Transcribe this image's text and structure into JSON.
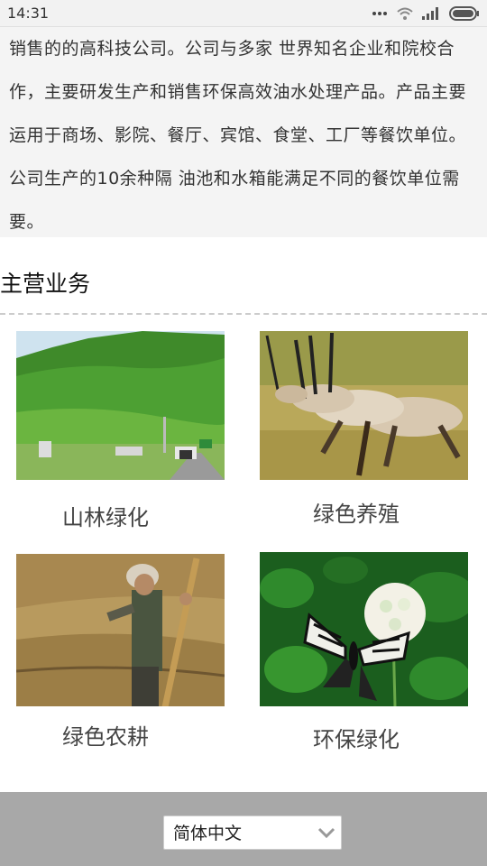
{
  "status_bar": {
    "time": "14:31",
    "icons": [
      "more-dots-icon",
      "wifi-icon",
      "signal-icon",
      "battery-icon"
    ]
  },
  "intro": {
    "paragraph": "销售的的高科技公司。公司与多家 世界知名企业和院校合作，主要研发生产和销售环保高效油水处理产品。产品主要运用于商场、影院、餐厅、宾馆、食堂、工厂等餐饮单位。公司生产的10余种隔 油池和水箱能满足不同的餐饮单位需要。"
  },
  "main_business": {
    "title": "主营业务",
    "items": [
      {
        "label": "山林绿化",
        "image": "forest-hill-highway-photo"
      },
      {
        "label": "绿色养殖",
        "image": "antelope-herd-photo"
      },
      {
        "label": "绿色农耕",
        "image": "farmer-hoeing-photo"
      },
      {
        "label": "环保绿化",
        "image": "butterfly-clover-photo"
      }
    ]
  },
  "footer": {
    "language_select": {
      "selected": "简体中文"
    }
  }
}
